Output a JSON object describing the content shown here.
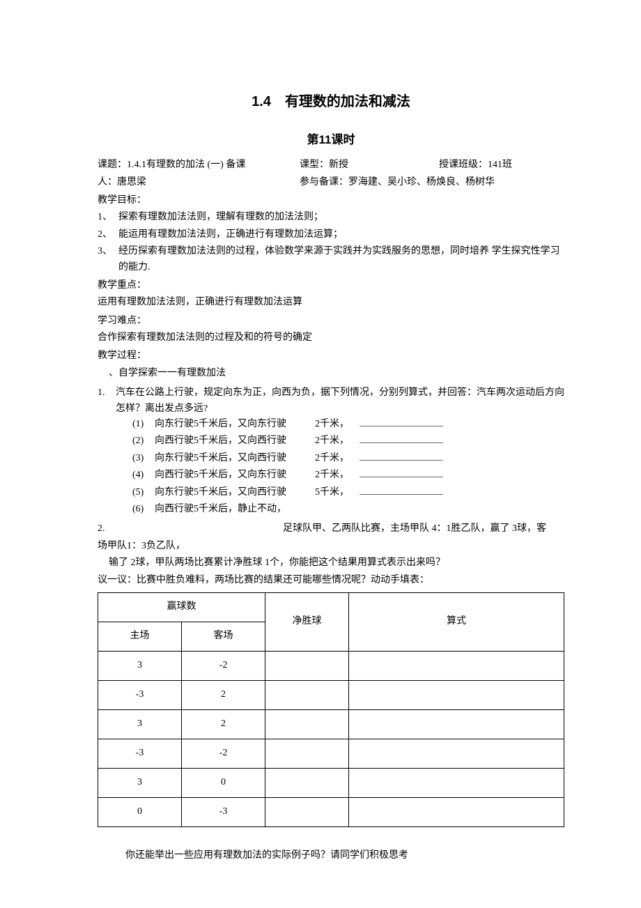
{
  "title": "1.4　有理数的加法和减法",
  "subtitle": "第11课时",
  "meta": {
    "topic_label": "课题：1.4.1有理数的加法 (一) 备课",
    "type_label": "课型：新授",
    "class_label": "授课班级：141班",
    "teacher_label": "人：唐思梁",
    "participants_label": "参与备课：罗海建、吴小珍、杨焕良、杨树华"
  },
  "goals": {
    "heading": "教学目标：",
    "items": [
      "探索有理数加法法则，理解有理数的加法法则；",
      "能运用有理数加法法则，正确进行有理数加法运算；",
      "经历探索有理数加法法则的过程，体验数学来源于实践并为实践服务的思想，同时培养 学生探究性学习的能力."
    ]
  },
  "keypoint": {
    "heading": "教学重点：",
    "text": "运用有理数加法法则，正确进行有理数加法运算"
  },
  "difficulty": {
    "heading": "学习难点：",
    "text": "合作探索有理数加法法则的过程及和的符号的确定"
  },
  "process_heading": "教学过程：",
  "self_study": "、自学探索一一有理数加法",
  "q1": {
    "num": "1.",
    "text": "汽车在公路上行驶，规定向东为正，向西为负，据下列情况，分别列算式，并回答：汽车两次运动后方向怎样？离出发点多远?",
    "subs": [
      {
        "idx": "(1)",
        "body": "向东行驶5千米后，又向东行驶",
        "dist": "2千米，"
      },
      {
        "idx": "(2)",
        "body": "向西行驶5千米后，又向西行驶",
        "dist": "2千米，"
      },
      {
        "idx": "(3)",
        "body": "向东行驶5千米后，又向西行驶",
        "dist": "2千米，"
      },
      {
        "idx": "(4)",
        "body": "向西行驶5千米后，又向东行驶",
        "dist": "2千米，"
      },
      {
        "idx": "(5)",
        "body": "向东行驶5千米后，又向西行驶",
        "dist": "5千米，"
      },
      {
        "idx": "(6)",
        "body": "向西行驶5千米后，静止不动，",
        "dist": ""
      }
    ]
  },
  "q2": {
    "num": "2.",
    "line1": "足球队甲、乙两队比赛，主场甲队 4：1胜乙队，赢了 3球，客",
    "line2": "场甲队1：3负乙队，",
    "line3": "输了 2球，甲队两场比赛累计净胜球 1个，你能把这个结果用算式表示出来吗？",
    "line4": "议一议：比赛中胜负难料，两场比赛的结果还可能哪些情况呢？动动手填表："
  },
  "table": {
    "head_win": "赢球数",
    "head_net": "净胜球",
    "head_expr": "算式",
    "sub_home": "主场",
    "sub_away": "客场",
    "rows": [
      {
        "home": "3",
        "away": "-2"
      },
      {
        "home": "-3",
        "away": "2"
      },
      {
        "home": "3",
        "away": "2"
      },
      {
        "home": "-3",
        "away": "-2"
      },
      {
        "home": "3",
        "away": "0"
      },
      {
        "home": "0",
        "away": "-3"
      }
    ]
  },
  "closing": "你还能举出一些应用有理数加法的实际例子吗？请同学们积极思考"
}
